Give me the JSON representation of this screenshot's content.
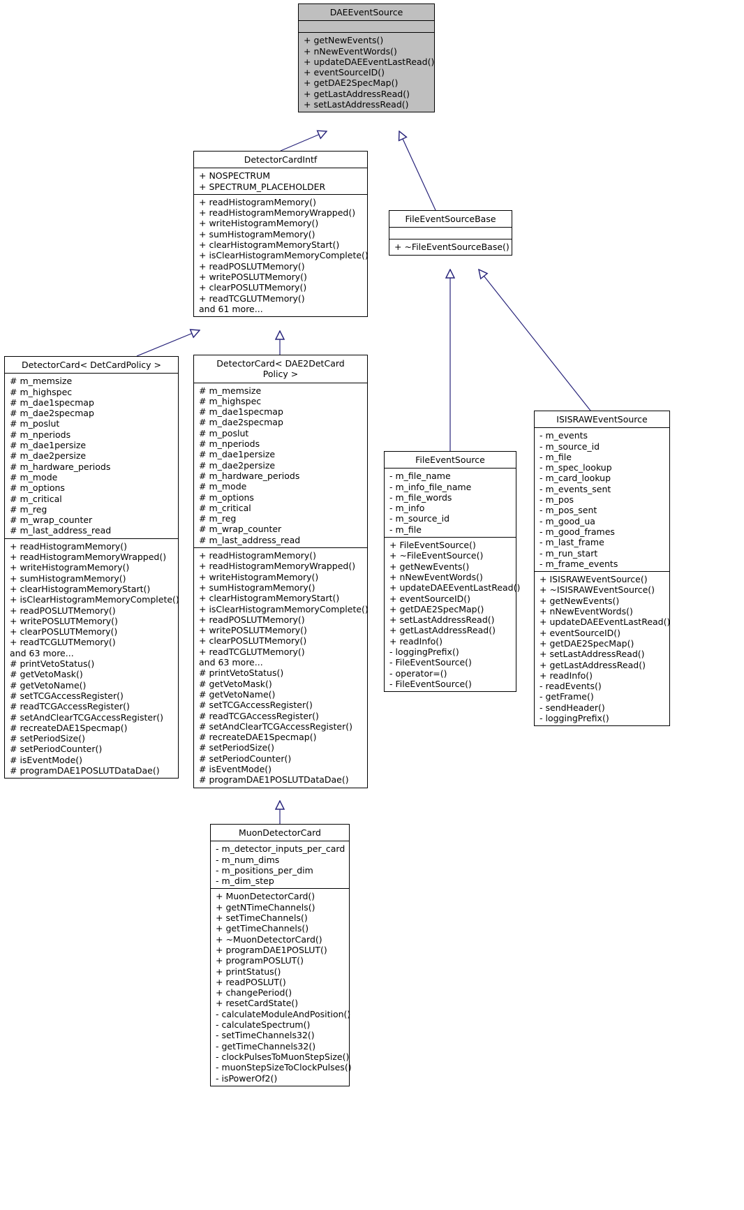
{
  "diagram": {
    "kind": "uml-class-inheritance-diagram",
    "edge_color": "#27237a",
    "root_fill": "#bfbfbf",
    "node_fill": "#ffffff",
    "border_color": "#000000"
  },
  "nodes": {
    "dae_event_source": {
      "title": "DAEEventSource",
      "attributes": [],
      "methods": [
        "+ getNewEvents()",
        "+ nNewEventWords()",
        "+ updateDAEEventLastRead()",
        "+ eventSourceID()",
        "+ getDAE2SpecMap()",
        "+ getLastAddressRead()",
        "+ setLastAddressRead()"
      ]
    },
    "detector_card_intf": {
      "title": "DetectorCardIntf",
      "attributes": [
        "+ NOSPECTRUM",
        "+ SPECTRUM_PLACEHOLDER"
      ],
      "methods": [
        "+ readHistogramMemory()",
        "+ readHistogramMemoryWrapped()",
        "+ writeHistogramMemory()",
        "+ sumHistogramMemory()",
        "+ clearHistogramMemoryStart()",
        "+ isClearHistogramMemoryComplete()",
        "+ readPOSLUTMemory()",
        "+ writePOSLUTMemory()",
        "+ clearPOSLUTMemory()",
        "+ readTCGLUTMemory()",
        "and 61 more..."
      ]
    },
    "file_event_source_base": {
      "title": "FileEventSourceBase",
      "attributes": [],
      "methods": [
        "+ ~FileEventSourceBase()"
      ]
    },
    "detector_card_det_card_policy": {
      "title": "DetectorCard< DetCardPolicy >",
      "attributes": [
        "# m_memsize",
        "# m_highspec",
        "# m_dae1specmap",
        "# m_dae2specmap",
        "# m_poslut",
        "# m_nperiods",
        "# m_dae1persize",
        "# m_dae2persize",
        "# m_hardware_periods",
        "# m_mode",
        "# m_options",
        "# m_critical",
        "# m_reg",
        "# m_wrap_counter",
        "# m_last_address_read"
      ],
      "methods": [
        "+ readHistogramMemory()",
        "+ readHistogramMemoryWrapped()",
        "+ writeHistogramMemory()",
        "+ sumHistogramMemory()",
        "+ clearHistogramMemoryStart()",
        "+ isClearHistogramMemoryComplete()",
        "+ readPOSLUTMemory()",
        "+ writePOSLUTMemory()",
        "+ clearPOSLUTMemory()",
        "+ readTCGLUTMemory()",
        "and 63 more...",
        "# printVetoStatus()",
        "# getVetoMask()",
        "# getVetoName()",
        "# setTCGAccessRegister()",
        "# readTCGAccessRegister()",
        "# setAndClearTCGAccessRegister()",
        "# recreateDAE1Specmap()",
        "# setPeriodSize()",
        "# setPeriodCounter()",
        "# isEventMode()",
        "# programDAE1POSLUTDataDae()"
      ]
    },
    "detector_card_dae2": {
      "title": "DetectorCard< DAE2DetCard\nPolicy >",
      "attributes": [
        "# m_memsize",
        "# m_highspec",
        "# m_dae1specmap",
        "# m_dae2specmap",
        "# m_poslut",
        "# m_nperiods",
        "# m_dae1persize",
        "# m_dae2persize",
        "# m_hardware_periods",
        "# m_mode",
        "# m_options",
        "# m_critical",
        "# m_reg",
        "# m_wrap_counter",
        "# m_last_address_read"
      ],
      "methods": [
        "+ readHistogramMemory()",
        "+ readHistogramMemoryWrapped()",
        "+ writeHistogramMemory()",
        "+ sumHistogramMemory()",
        "+ clearHistogramMemoryStart()",
        "+ isClearHistogramMemoryComplete()",
        "+ readPOSLUTMemory()",
        "+ writePOSLUTMemory()",
        "+ clearPOSLUTMemory()",
        "+ readTCGLUTMemory()",
        "and 63 more...",
        "# printVetoStatus()",
        "# getVetoMask()",
        "# getVetoName()",
        "# setTCGAccessRegister()",
        "# readTCGAccessRegister()",
        "# setAndClearTCGAccessRegister()",
        "# recreateDAE1Specmap()",
        "# setPeriodSize()",
        "# setPeriodCounter()",
        "# isEventMode()",
        "# programDAE1POSLUTDataDae()"
      ]
    },
    "file_event_source": {
      "title": "FileEventSource",
      "attributes": [
        "- m_file_name",
        "- m_info_file_name",
        "- m_file_words",
        "- m_info",
        "- m_source_id",
        "- m_file"
      ],
      "methods": [
        "+ FileEventSource()",
        "+ ~FileEventSource()",
        "+ getNewEvents()",
        "+ nNewEventWords()",
        "+ updateDAEEventLastRead()",
        "+ eventSourceID()",
        "+ getDAE2SpecMap()",
        "+ setLastAddressRead()",
        "+ getLastAddressRead()",
        "+ readInfo()",
        "- loggingPrefix()",
        "- FileEventSource()",
        "- operator=()",
        "- FileEventSource()"
      ]
    },
    "isisraw_event_source": {
      "title": "ISISRAWEventSource",
      "attributes": [
        "- m_events",
        "- m_source_id",
        "- m_file",
        "- m_spec_lookup",
        "- m_card_lookup",
        "- m_events_sent",
        "- m_pos",
        "- m_pos_sent",
        "- m_good_ua",
        "- m_good_frames",
        "- m_last_frame",
        "- m_run_start",
        "- m_frame_events"
      ],
      "methods": [
        "+ ISISRAWEventSource()",
        "+ ~ISISRAWEventSource()",
        "+ getNewEvents()",
        "+ nNewEventWords()",
        "+ updateDAEEventLastRead()",
        "+ eventSourceID()",
        "+ getDAE2SpecMap()",
        "+ setLastAddressRead()",
        "+ getLastAddressRead()",
        "+ readInfo()",
        "- readEvents()",
        "- getFrame()",
        "- sendHeader()",
        "- loggingPrefix()"
      ]
    },
    "muon_detector_card": {
      "title": "MuonDetectorCard",
      "attributes": [
        "- m_detector_inputs_per_card",
        "- m_num_dims",
        "- m_positions_per_dim",
        "- m_dim_step"
      ],
      "methods": [
        "+ MuonDetectorCard()",
        "+ getNTimeChannels()",
        "+ setTimeChannels()",
        "+ getTimeChannels()",
        "+ ~MuonDetectorCard()",
        "+ programDAE1POSLUT()",
        "+ programPOSLUT()",
        "+ printStatus()",
        "+ readPOSLUT()",
        "+ changePeriod()",
        "+ resetCardState()",
        "- calculateModuleAndPosition()",
        "- calculateSpectrum()",
        "- setTimeChannels32()",
        "- getTimeChannels32()",
        "- clockPulsesToMuonStepSize()",
        "- muonStepSizeToClockPulses()",
        "- isPowerOf2()"
      ]
    }
  },
  "edges": [
    {
      "from": "detector_card_intf",
      "to": "dae_event_source",
      "type": "inheritance"
    },
    {
      "from": "file_event_source_base",
      "to": "dae_event_source",
      "type": "inheritance"
    },
    {
      "from": "detector_card_det_card_policy",
      "to": "detector_card_intf",
      "type": "inheritance"
    },
    {
      "from": "detector_card_dae2",
      "to": "detector_card_intf",
      "type": "inheritance"
    },
    {
      "from": "file_event_source",
      "to": "file_event_source_base",
      "type": "inheritance"
    },
    {
      "from": "isisraw_event_source",
      "to": "file_event_source_base",
      "type": "inheritance"
    },
    {
      "from": "muon_detector_card",
      "to": "detector_card_dae2",
      "type": "inheritance"
    }
  ]
}
